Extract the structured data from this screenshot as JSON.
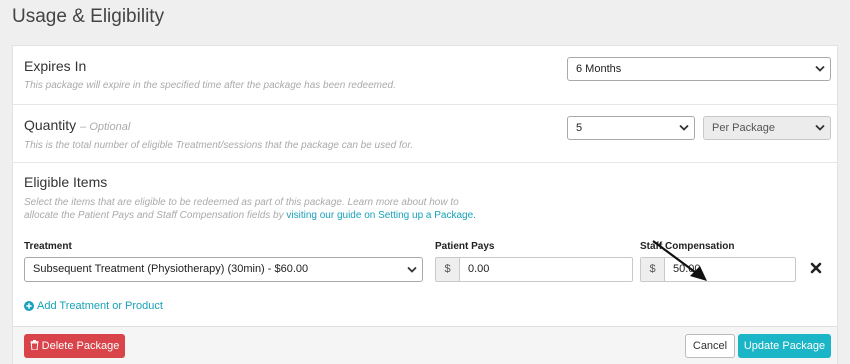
{
  "page": {
    "title": "Usage & Eligibility"
  },
  "expires": {
    "title": "Expires In",
    "help": "This package will expire in the specified time after the package has been redeemed.",
    "value": "6 Months"
  },
  "quantity": {
    "title": "Quantity",
    "optional": "– Optional",
    "help": "This is the total number of eligible Treatment/sessions that the package can be used for.",
    "value": "5",
    "unit": "Per Package"
  },
  "eligible": {
    "title": "Eligible Items",
    "help_line1": "Select the items that are eligible to be redeemed as part of this package. Learn more about how to",
    "help_line2_prefix": "allocate the Patient Pays and Staff Compensation fields by ",
    "help_link": "visiting our guide on Setting up a Package.",
    "columns": {
      "treatment": "Treatment",
      "patient_pays": "Patient Pays",
      "staff_comp": "Staff Compensation"
    },
    "items": [
      {
        "treatment": "Subsequent Treatment (Physiotherapy) (30min) - $60.00",
        "currency": "$",
        "patient_pays": "0.00",
        "staff_comp": "50.00"
      }
    ],
    "add_label": "Add Treatment or Product"
  },
  "footer": {
    "delete_label": "Delete Package",
    "cancel_label": "Cancel",
    "update_label": "Update Package"
  },
  "colors": {
    "accent": "#1ab5c6",
    "danger": "#d9434a",
    "link": "#17a2b8"
  },
  "icons": [
    "chevron-down-icon",
    "close-icon",
    "plus-circle-icon",
    "trash-icon",
    "arrow-annotation"
  ]
}
